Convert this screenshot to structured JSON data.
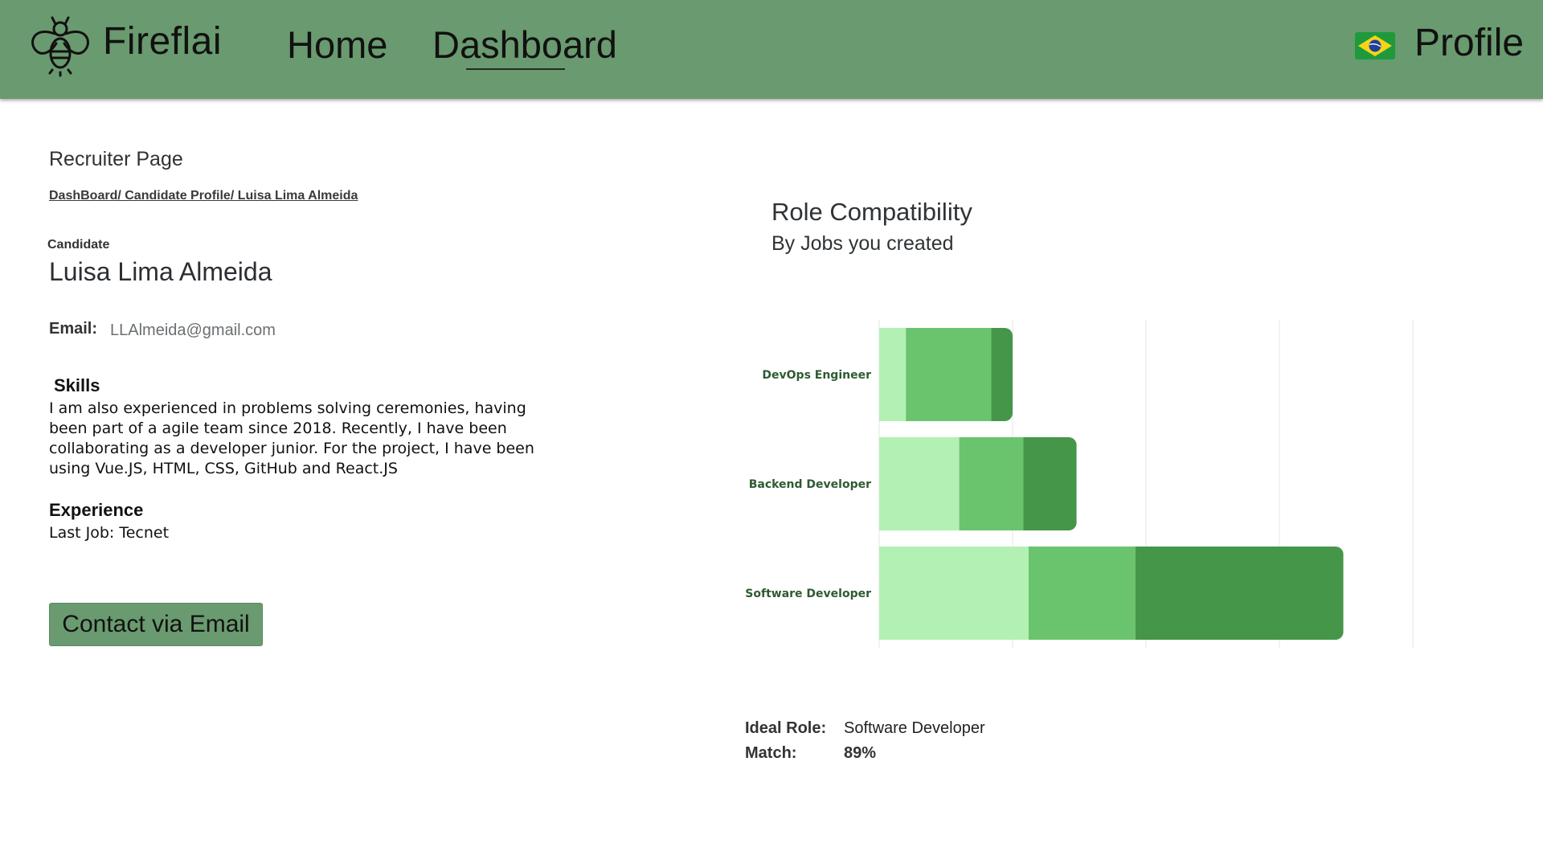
{
  "header": {
    "brand": "Fireflai",
    "nav": {
      "home": "Home",
      "dashboard": "Dashboard"
    },
    "profile": "Profile",
    "logo_icon": "firefly-icon",
    "flag_icon": "brazil-flag-icon",
    "background_color": "#6a9a6f"
  },
  "page": {
    "title": "Recruiter Page",
    "breadcrumb": "DashBoard/ Candidate Profile/ Luisa Lima Almeida"
  },
  "candidate": {
    "label": "Candidate",
    "name": "Luisa Lima Almeida",
    "email_label": "Email:",
    "email": "LLAlmeida@gmail.com",
    "skills_title": "Skills",
    "skills_text": "I am also experienced in problems solving ceremonies, having been part of a agile team since 2018. Recently, I have been collaborating as a developer junior. For the project, I have been using Vue.JS, HTML, CSS, GitHub and React.JS",
    "experience_title": "Experience",
    "experience_text": "Last Job: Tecnet",
    "contact_button": "Contact via Email"
  },
  "compatibility": {
    "title": "Role Compatibility",
    "subtitle": "By Jobs you created",
    "ideal_role_label": "Ideal Role:",
    "ideal_role": "Software Developer",
    "match_label": "Match:",
    "match": "89%"
  },
  "chart_data": {
    "type": "bar",
    "orientation": "horizontal",
    "stacked": true,
    "categories": [
      "DevOps Engineer",
      "Backend Developer",
      "Software Developer"
    ],
    "series": [
      {
        "values": [
          5,
          15,
          28
        ],
        "color": "#b3f0b3"
      },
      {
        "values": [
          16,
          12,
          20
        ],
        "color": "#6ac46d"
      },
      {
        "values": [
          4,
          10,
          39
        ],
        "color": "#46964a"
      }
    ],
    "xlim": [
      0,
      100
    ],
    "xticks": [
      0,
      25,
      50,
      75,
      100
    ],
    "grid": true,
    "label_color": "#2e5a32"
  }
}
